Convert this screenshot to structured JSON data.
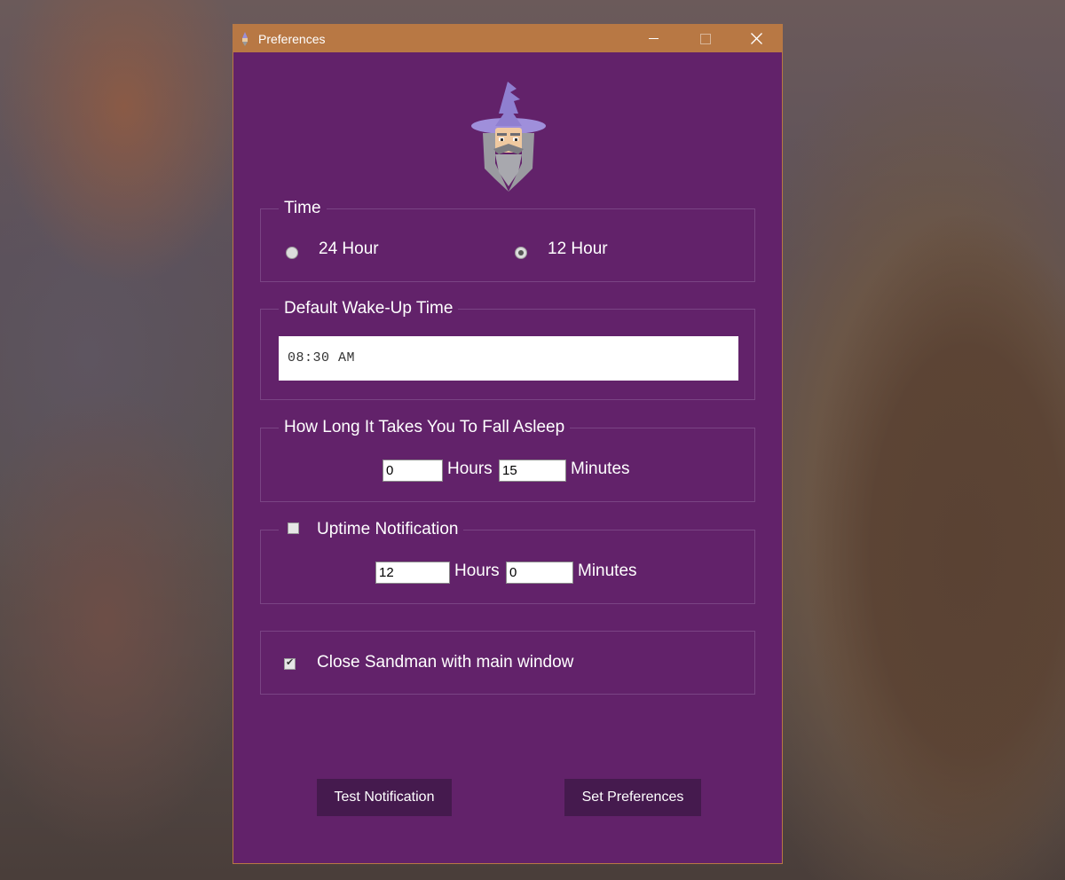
{
  "window": {
    "title": "Preferences"
  },
  "logo": {
    "icon": "wizard-icon"
  },
  "time_group": {
    "legend": "Time",
    "option_24": "24 Hour",
    "option_12": "12 Hour",
    "selected": "12 Hour"
  },
  "wakeup_group": {
    "legend": "Default Wake-Up Time",
    "time_value": "08:30 AM"
  },
  "fall_asleep_group": {
    "legend": "How Long It Takes You To Fall Asleep",
    "hours_value": "0",
    "hours_label": "Hours",
    "minutes_value": "15",
    "minutes_label": "Minutes"
  },
  "uptime_group": {
    "legend": "Uptime Notification",
    "enabled": false,
    "hours_value": "12",
    "hours_label": "Hours",
    "minutes_value": "0",
    "minutes_label": "Minutes"
  },
  "close_group": {
    "label": "Close Sandman with main window",
    "checked": true
  },
  "buttons": {
    "test": "Test Notification",
    "set": "Set Preferences"
  },
  "colors": {
    "window_bg": "#62226a",
    "titlebar": "#b87844",
    "button_bg": "#451a4e"
  }
}
